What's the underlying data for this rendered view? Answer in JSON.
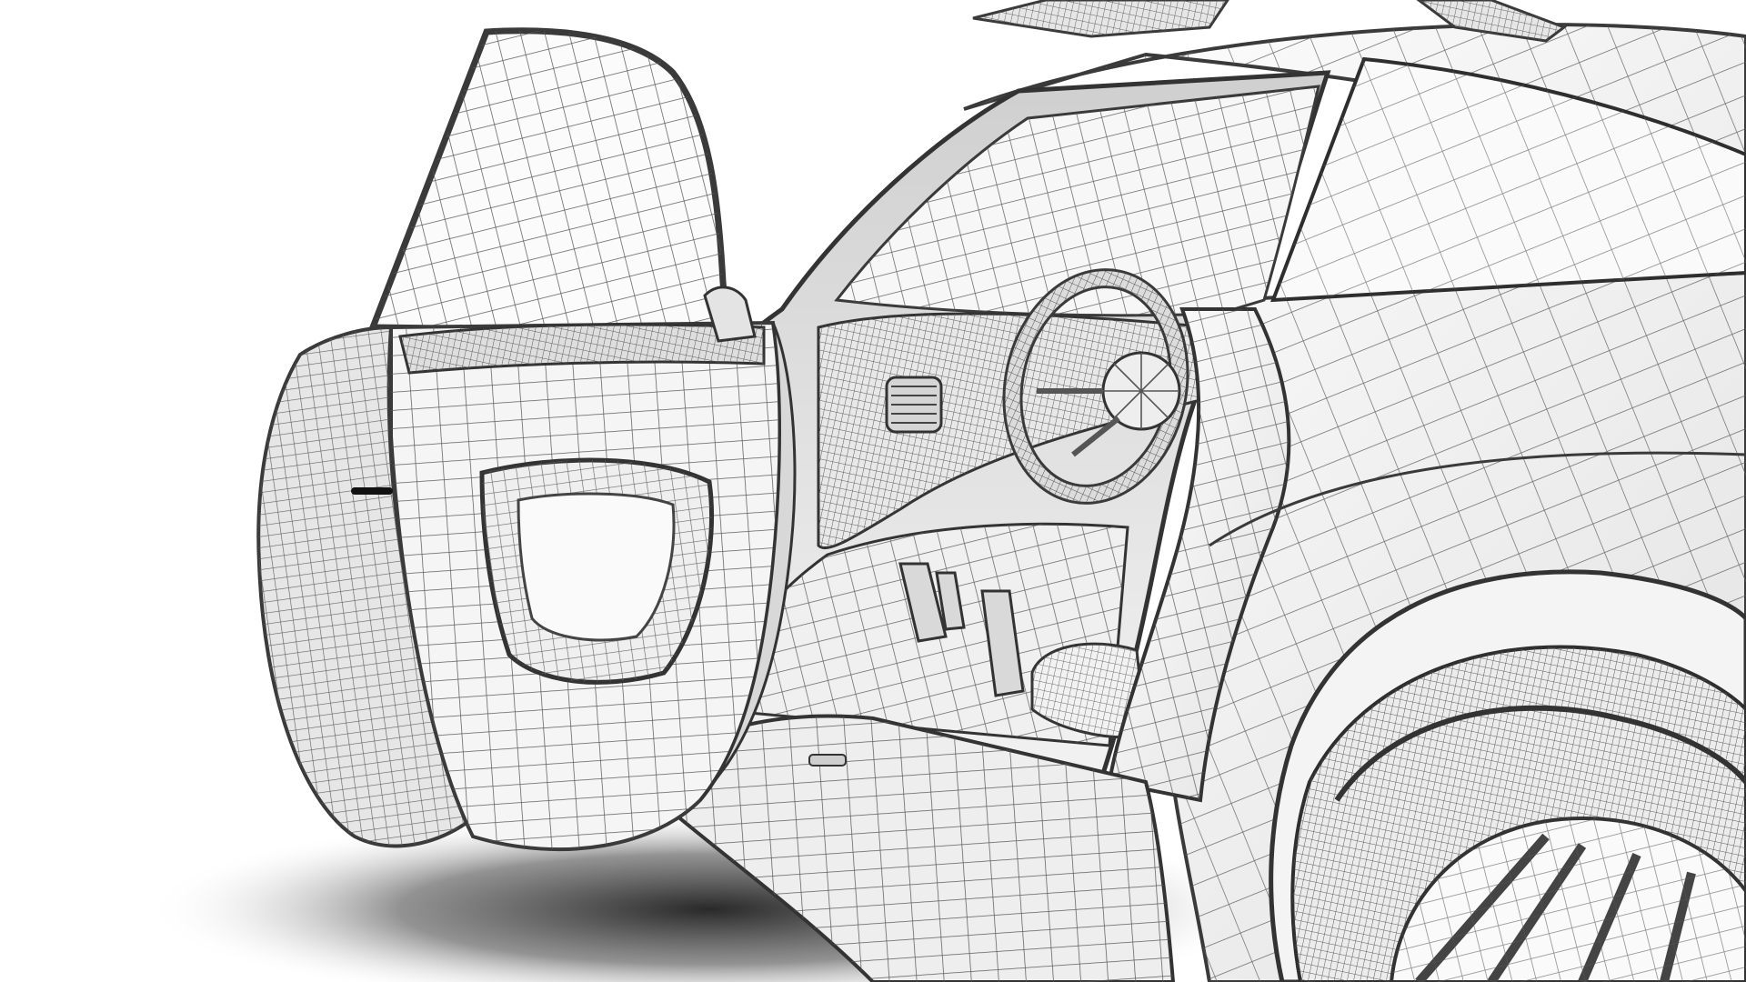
{
  "scene": {
    "subject_icon": "car-wireframe-icon",
    "colors": {
      "background": "#ffffff",
      "wire": "#5a5a5a",
      "wire_dark": "#3a3a3a",
      "shadow": "#2b2b2b",
      "surface_light": "#f4f4f4",
      "surface_mid": "#d8d8d8"
    }
  }
}
